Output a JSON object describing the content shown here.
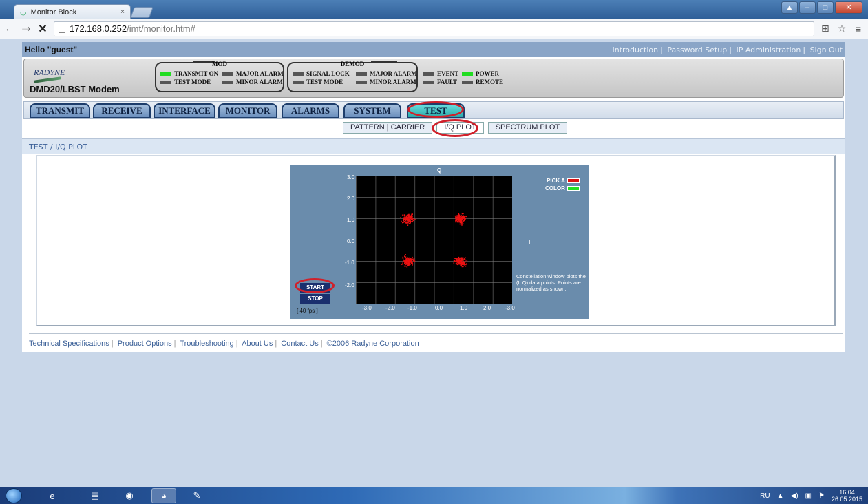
{
  "browser": {
    "tab_title": "Monitor Block",
    "tab_close": "×",
    "nav_back": "←",
    "nav_forward": "⇒",
    "nav_stop": "✕",
    "url_host": "172.168.0.252",
    "url_path": "/imt/monitor.htm#",
    "translate_icon": "translate-icon",
    "star_icon": "☆",
    "menu_icon": "≡"
  },
  "header": {
    "greeting": "Hello \"guest\"",
    "links": [
      "Introduction",
      "Password Setup",
      "IP Administration",
      "Sign Out"
    ],
    "logo": "RADYNE",
    "model": "DMD20/LBST Modem"
  },
  "status": {
    "mod_title": "MOD",
    "demod_title": "DEMOD",
    "mod_leds": [
      {
        "label": "TRANSMIT ON",
        "on": true
      },
      {
        "label": "MAJOR ALARM",
        "on": false
      },
      {
        "label": "TEST MODE",
        "on": false
      },
      {
        "label": "MINOR ALARM",
        "on": false
      }
    ],
    "demod_leds": [
      {
        "label": "SIGNAL LOCK",
        "on": false
      },
      {
        "label": "MAJOR ALARM",
        "on": false
      },
      {
        "label": "TEST MODE",
        "on": false
      },
      {
        "label": "MINOR ALARM",
        "on": false
      }
    ],
    "other_leds": [
      {
        "label": "EVENT",
        "on": false
      },
      {
        "label": "POWER",
        "on": true
      },
      {
        "label": "FAULT",
        "on": false
      },
      {
        "label": "REMOTE",
        "on": false
      }
    ]
  },
  "tabs": [
    "TRANSMIT",
    "RECEIVE",
    "INTERFACE",
    "MONITOR",
    "ALARMS",
    "SYSTEM",
    "TEST"
  ],
  "active_tab": "TEST",
  "subtabs": [
    "PATTERN | CARRIER",
    "I/Q PLOT",
    "SPECTRUM PLOT"
  ],
  "active_subtab": "I/Q PLOT",
  "breadcrumb": "TEST / I/Q PLOT",
  "plot": {
    "q_label": "Q",
    "i_label": "I",
    "y_ticks": [
      "3.0",
      "2.0",
      "1.0",
      "0.0",
      "-1.0",
      "-2.0"
    ],
    "x_ticks": [
      "-3.0",
      "-2.0",
      "-1.0",
      "0.0",
      "1.0",
      "2.0",
      "-3.0"
    ],
    "pick_label_1": "PICK A",
    "pick_label_2": "COLOR",
    "pick_colors": [
      "#dd1111",
      "#22dd22"
    ],
    "point_color": "#ee1111",
    "note": "Constellation window plots the (I, Q) data points. Points are normalized as shown.",
    "start_label": "START",
    "stop_label": "STOP",
    "fps": "[ 40 fps ]"
  },
  "chart_data": {
    "type": "scatter",
    "title": "",
    "xlabel": "I",
    "ylabel": "Q",
    "xlim": [
      -3.0,
      3.0
    ],
    "ylim": [
      -3.0,
      3.0
    ],
    "grid": true,
    "series": [
      {
        "values": [
          [
            -1.0,
            1.0
          ],
          [
            1.0,
            1.0
          ],
          [
            -1.0,
            -1.0
          ],
          [
            1.0,
            -1.0
          ]
        ]
      }
    ]
  },
  "footer": [
    "Technical Specifications",
    "Product Options",
    "Troubleshooting",
    "About Us",
    "Contact Us",
    "©2006 Radyne Corporation"
  ],
  "taskbar": {
    "lang": "RU",
    "time": "16:04",
    "date": "26.05.2015"
  }
}
